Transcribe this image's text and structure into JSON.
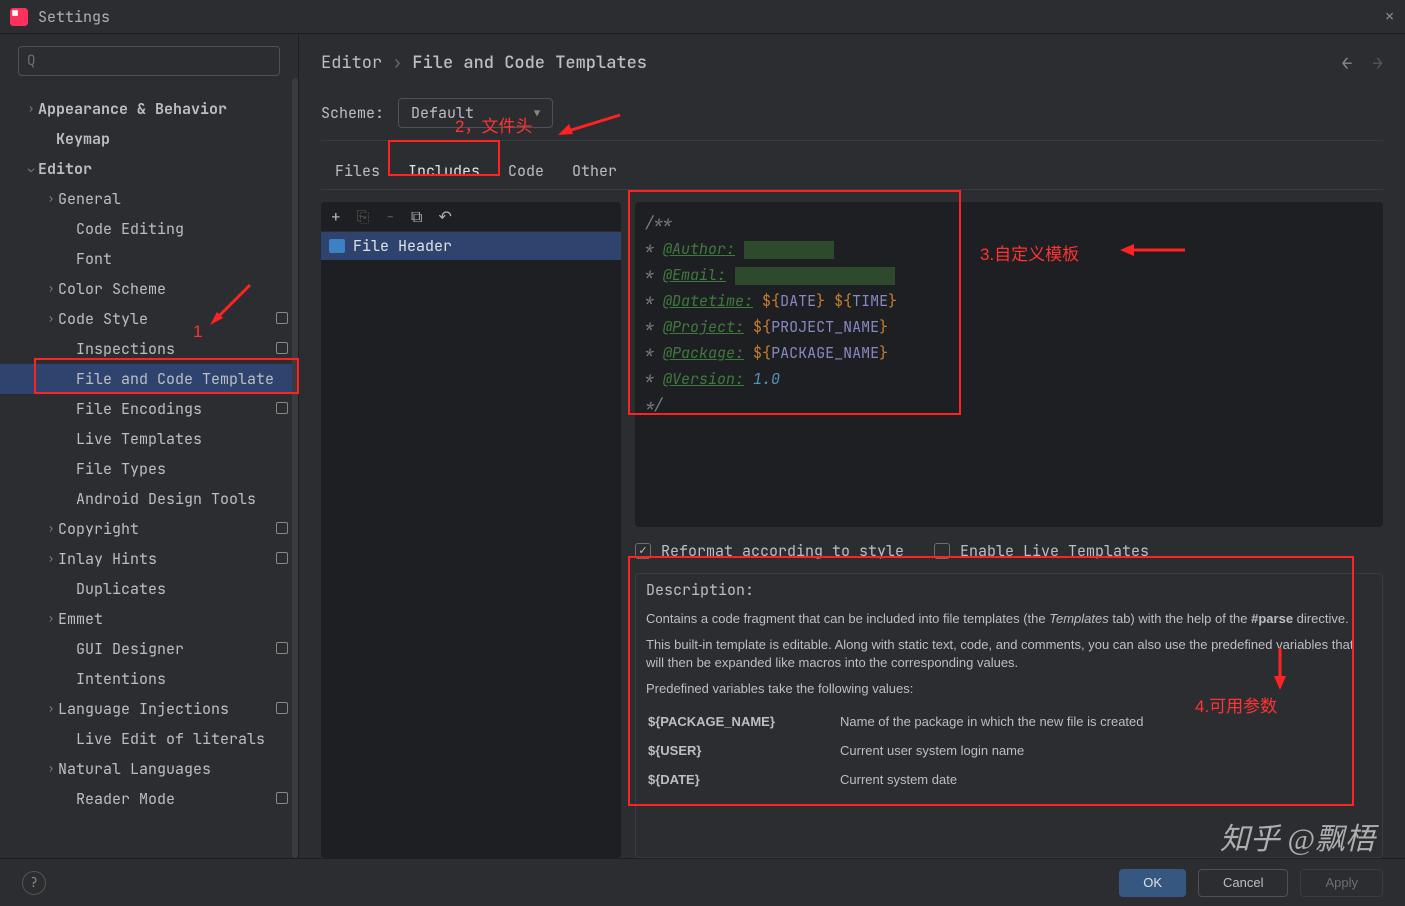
{
  "window": {
    "title": "Settings"
  },
  "sidebar": {
    "items": [
      {
        "label": "Appearance & Behavior",
        "chev": ">",
        "bold": true,
        "indent": 24
      },
      {
        "label": "Keymap",
        "chev": "",
        "bold": true,
        "indent": 42
      },
      {
        "label": "Editor",
        "chev": "v",
        "bold": true,
        "indent": 24
      },
      {
        "label": "General",
        "chev": ">",
        "indent": 44
      },
      {
        "label": "Code Editing",
        "chev": "",
        "indent": 62
      },
      {
        "label": "Font",
        "chev": "",
        "indent": 62
      },
      {
        "label": "Color Scheme",
        "chev": ">",
        "indent": 44
      },
      {
        "label": "Code Style",
        "chev": ">",
        "indent": 44,
        "badge": true
      },
      {
        "label": "Inspections",
        "chev": "",
        "indent": 62,
        "badge": true
      },
      {
        "label": "File and Code Template",
        "chev": "",
        "indent": 62,
        "sel": true
      },
      {
        "label": "File Encodings",
        "chev": "",
        "indent": 62,
        "badge": true
      },
      {
        "label": "Live Templates",
        "chev": "",
        "indent": 62
      },
      {
        "label": "File Types",
        "chev": "",
        "indent": 62
      },
      {
        "label": "Android Design Tools",
        "chev": "",
        "indent": 62
      },
      {
        "label": "Copyright",
        "chev": ">",
        "indent": 44,
        "badge": true
      },
      {
        "label": "Inlay Hints",
        "chev": ">",
        "indent": 44,
        "badge": true
      },
      {
        "label": "Duplicates",
        "chev": "",
        "indent": 62
      },
      {
        "label": "Emmet",
        "chev": ">",
        "indent": 44
      },
      {
        "label": "GUI Designer",
        "chev": "",
        "indent": 62,
        "badge": true
      },
      {
        "label": "Intentions",
        "chev": "",
        "indent": 62
      },
      {
        "label": "Language Injections",
        "chev": ">",
        "indent": 44,
        "badge": true
      },
      {
        "label": "Live Edit of literals",
        "chev": "",
        "indent": 62
      },
      {
        "label": "Natural Languages",
        "chev": ">",
        "indent": 44
      },
      {
        "label": "Reader Mode",
        "chev": "",
        "indent": 62,
        "badge": true
      }
    ]
  },
  "breadcrumb": {
    "p1": "Editor",
    "p2": "File and Code Templates"
  },
  "scheme": {
    "label": "Scheme:",
    "value": "Default"
  },
  "tabs": [
    {
      "label": "Files"
    },
    {
      "label": "Includes",
      "active": true
    },
    {
      "label": "Code"
    },
    {
      "label": "Other"
    }
  ],
  "list": {
    "items": [
      {
        "label": "File Header",
        "sel": true
      }
    ]
  },
  "template": {
    "open": "/**",
    "author": "@Author:",
    "email": "@Email:",
    "datetime": "@Datetime:",
    "project": "@Project:",
    "package": "@Package:",
    "version": "@Version:",
    "version_val": "1.0",
    "vs": "${",
    "ve": "}",
    "DATE": "DATE",
    "TIME": "TIME",
    "PROJECT": "PROJECT_NAME",
    "PACKAGE": "PACKAGE_NAME",
    "close": "*/"
  },
  "checks": {
    "reformat": "Reformat according to style",
    "livetpl": "Enable Live Templates"
  },
  "desc": {
    "title": "Description:",
    "p1a": "Contains a code fragment that can be included into file templates (the ",
    "p1b": "Templates",
    "p1c": " tab) with the help of the ",
    "p1d": "#parse",
    "p1e": " directive.",
    "p2": "This built-in template is editable. Along with static text, code, and comments, you can also use the predefined variables that will then be expanded like macros into the corresponding values.",
    "p3": "Predefined variables take the following values:",
    "vars": [
      {
        "k": "${PACKAGE_NAME}",
        "v": "Name of the package in which the new file is created"
      },
      {
        "k": "${USER}",
        "v": "Current user system login name"
      },
      {
        "k": "${DATE}",
        "v": "Current system date"
      }
    ]
  },
  "buttons": {
    "ok": "OK",
    "cancel": "Cancel",
    "apply": "Apply"
  },
  "anno": {
    "a1": "1",
    "a2": "2，文件头",
    "a3": "3.自定义模板",
    "a4": "4.可用参数"
  },
  "watermark": "知乎 @飘梧"
}
